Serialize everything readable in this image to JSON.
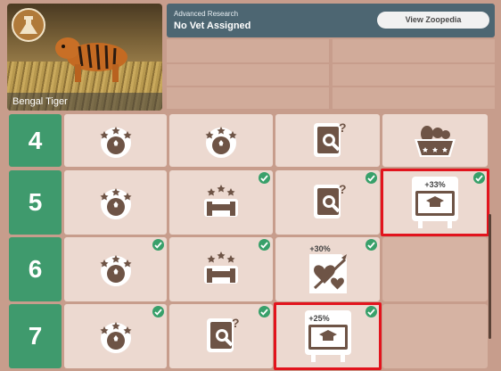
{
  "animal": {
    "name": "Bengal Tiger"
  },
  "research": {
    "subtitle": "Advanced Research",
    "vet_status": "No Vet Assigned",
    "zoopedia_button": "View Zoopedia"
  },
  "rows": [
    {
      "label": "4",
      "cells": [
        "enrichment-ball-icon",
        "enrichment-ball-icon",
        "research-book-icon",
        "food-basket-icon"
      ]
    },
    {
      "label": "5",
      "cells": [
        "enrichment-ball-icon",
        "enrichment-stand-icon",
        "research-book-icon",
        "education-board-icon"
      ],
      "bonus": "+33%"
    },
    {
      "label": "6",
      "cells": [
        "enrichment-ball-icon",
        "enrichment-stand-icon",
        "breeding-heart-icon",
        ""
      ],
      "bonus": "+30%"
    },
    {
      "label": "7",
      "cells": [
        "enrichment-ball-icon",
        "research-book-icon",
        "education-board-icon",
        ""
      ],
      "bonus": "+25%"
    }
  ],
  "bonuses": {
    "row5_col4": "+33%",
    "row6_col3": "+30%",
    "row7_col3": "+25%"
  },
  "colors": {
    "row_label": "#3f9a6d",
    "highlight": "#e2141d",
    "header": "#4d6672"
  }
}
